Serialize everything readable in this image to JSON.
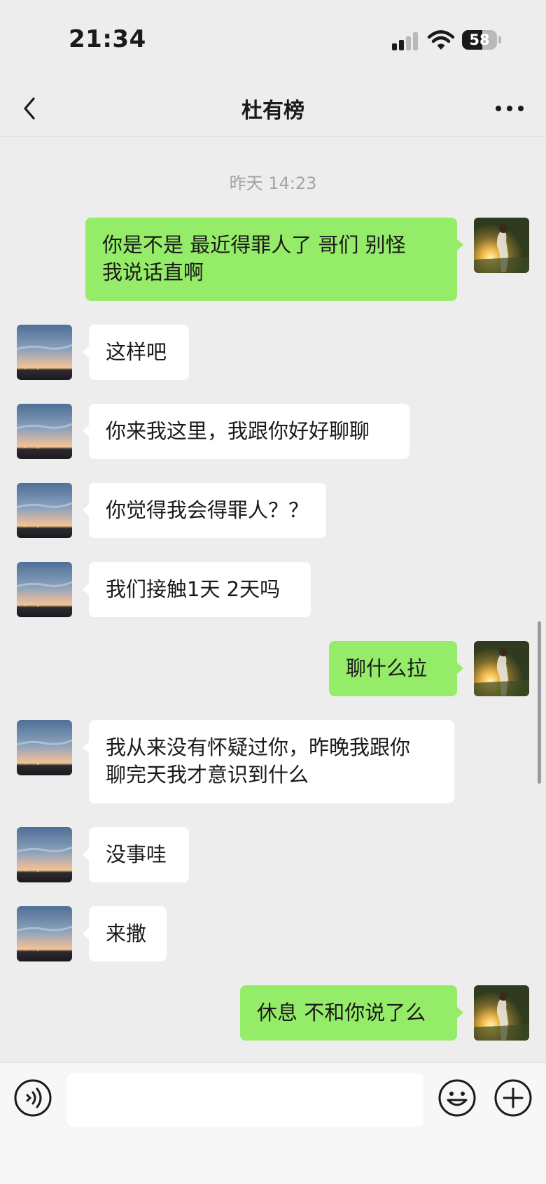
{
  "status_bar": {
    "time": "21:34",
    "battery": "58",
    "battery_level": 0.58
  },
  "header": {
    "title": "杜有榜"
  },
  "chat": {
    "timestamp": "昨天 14:23",
    "messages": [
      {
        "side": "right",
        "text": "你是不是 最近得罪人了 哥们  别怪\n我说话直啊"
      },
      {
        "side": "left",
        "text": "这样吧"
      },
      {
        "side": "left",
        "text": "你来我这里，我跟你好好聊聊"
      },
      {
        "side": "left",
        "text": "你觉得我会得罪人？？"
      },
      {
        "side": "left",
        "text": "我们接触1天 2天吗"
      },
      {
        "side": "right",
        "text": "聊什么拉"
      },
      {
        "side": "left",
        "text": "我从来没有怀疑过你，昨晚我跟你\n聊完天我才意识到什么"
      },
      {
        "side": "left",
        "text": "没事哇"
      },
      {
        "side": "left",
        "text": "来撒"
      },
      {
        "side": "right",
        "text": "休息 不和你说了么"
      }
    ]
  },
  "input_bar": {
    "message_value": ""
  },
  "colors": {
    "background": "#ededed",
    "sent_bubble": "#95ec69",
    "received_bubble": "#ffffff"
  }
}
